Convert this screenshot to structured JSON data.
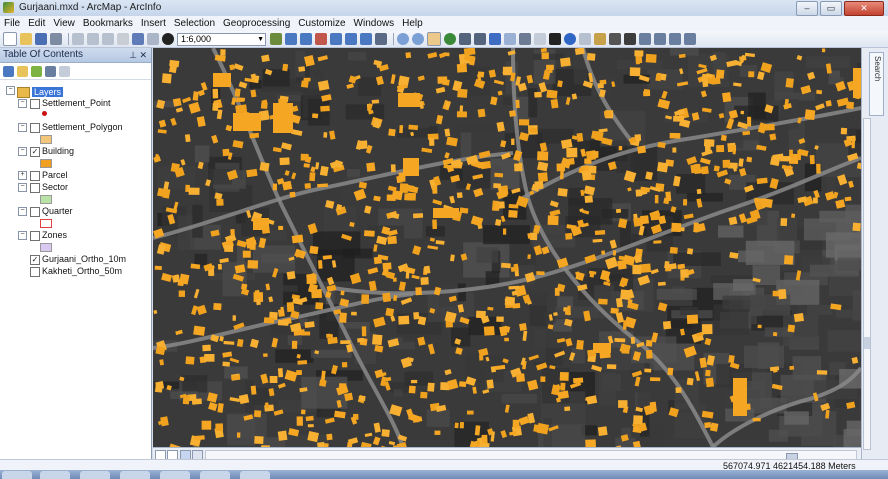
{
  "window": {
    "title": "Gurjaani.mxd - ArcMap - ArcInfo"
  },
  "menu": [
    "File",
    "Edit",
    "View",
    "Bookmarks",
    "Insert",
    "Selection",
    "Geoprocessing",
    "Customize",
    "Windows",
    "Help"
  ],
  "toolbar": {
    "scale": "1:6,000"
  },
  "toc": {
    "title": "Table Of Contents",
    "root_label": "Layers",
    "layers": [
      {
        "name": "Settlement_Point",
        "checked": false,
        "expanded": true,
        "symbol": "point",
        "color": "#cc1111"
      },
      {
        "name": "Settlement_Polygon",
        "checked": false,
        "expanded": true,
        "symbol": "fill",
        "color": "#f2c77a"
      },
      {
        "name": "Building",
        "checked": true,
        "expanded": true,
        "symbol": "fill",
        "color": "#f0a020"
      },
      {
        "name": "Parcel",
        "checked": false,
        "expanded": false,
        "symbol": "none",
        "color": ""
      },
      {
        "name": "Sector",
        "checked": false,
        "expanded": true,
        "symbol": "fill",
        "color": "#b8e2a6"
      },
      {
        "name": "Quarter",
        "checked": false,
        "expanded": true,
        "symbol": "outline",
        "color": "#e04040"
      },
      {
        "name": "Zones",
        "checked": false,
        "expanded": true,
        "symbol": "fill",
        "color": "#d9c8ef"
      },
      {
        "name": "Gurjaani_Ortho_10m",
        "checked": true,
        "expanded": false,
        "symbol": "none",
        "color": ""
      },
      {
        "name": "Kakheti_Ortho_50m",
        "checked": false,
        "expanded": false,
        "symbol": "none",
        "color": ""
      }
    ]
  },
  "search_panel": {
    "label": "Search"
  },
  "status": {
    "coordinates": "567074.971  4621454.188 Meters"
  },
  "colors": {
    "building": "#f5a623",
    "imagery_dark": "#2f2f2f",
    "selection": "#3875d7"
  }
}
